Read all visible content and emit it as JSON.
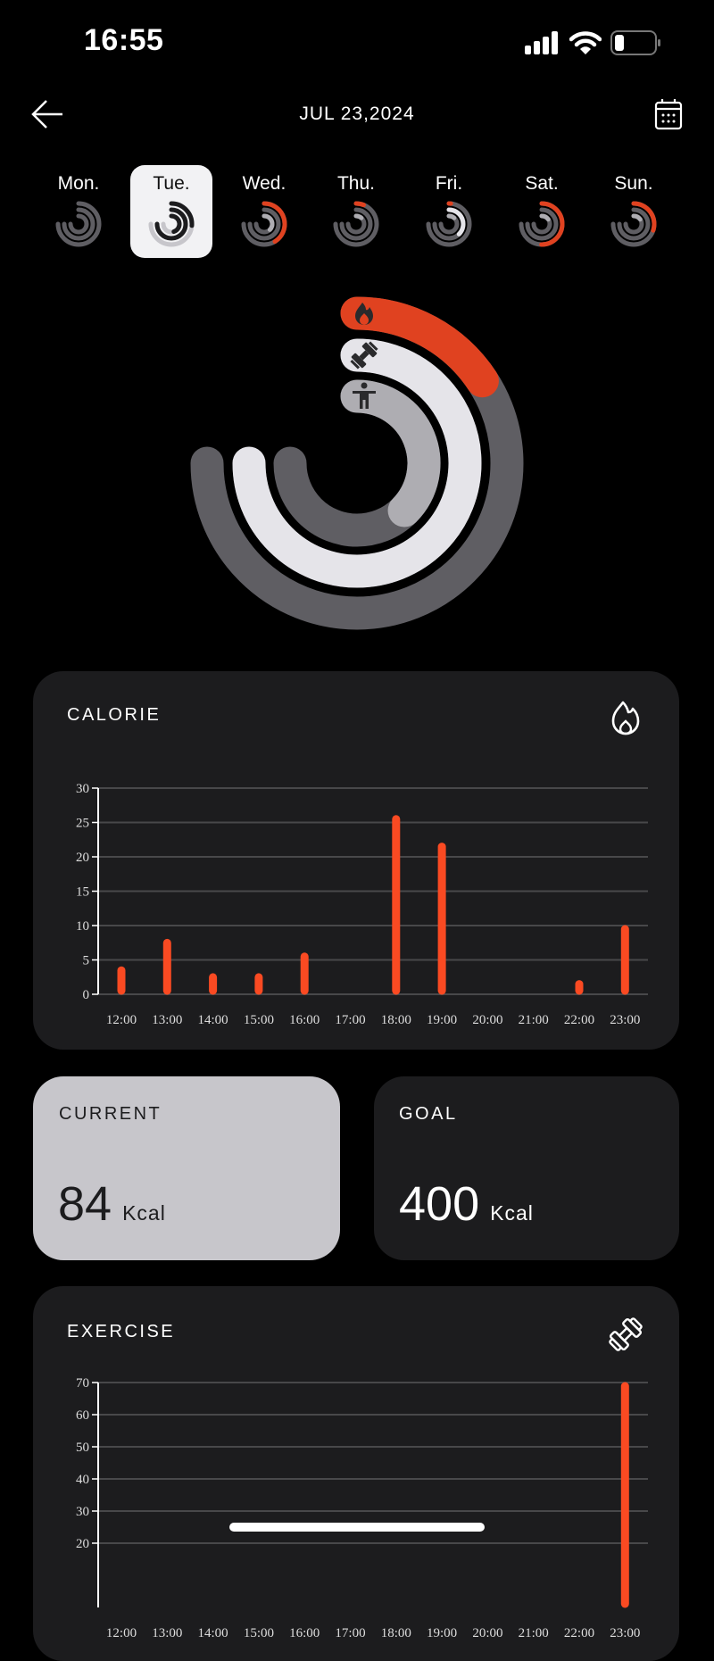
{
  "status_bar": {
    "time": "16:55",
    "signal_icon": "cellular-signal-icon",
    "wifi_icon": "wifi-icon",
    "battery_icon": "battery-low-icon"
  },
  "header": {
    "back_icon": "arrow-left-icon",
    "title": "JUL 23,2024",
    "calendar_icon": "calendar-icon"
  },
  "days": [
    {
      "label": "Mon.",
      "selected": false,
      "rings": [
        0,
        0,
        0
      ]
    },
    {
      "label": "Tue.",
      "selected": true,
      "rings": [
        0.35,
        1,
        0.6
      ]
    },
    {
      "label": "Wed.",
      "selected": false,
      "rings": [
        0.55,
        0,
        0.5
      ]
    },
    {
      "label": "Thu.",
      "selected": false,
      "rings": [
        0.08,
        0,
        0.15
      ]
    },
    {
      "label": "Fri.",
      "selected": false,
      "rings": [
        0.02,
        0.5,
        0.15
      ]
    },
    {
      "label": "Sat.",
      "selected": false,
      "rings": [
        0.67,
        0,
        0.2
      ]
    },
    {
      "label": "Sun.",
      "selected": false,
      "rings": [
        0.4,
        0,
        0.2
      ]
    }
  ],
  "activity_rings": {
    "calorie": {
      "progress": 0.21,
      "icon": "flame-icon",
      "color": "#e04220"
    },
    "exercise": {
      "progress": 1.0,
      "icon": "dumbbell-icon",
      "color": "#e5e4e9"
    },
    "stand": {
      "progress": 0.5,
      "icon": "person-standing-icon",
      "color": "#aeadb2"
    },
    "track_color": "#5f5e63"
  },
  "calorie_card": {
    "title": "CALORIE",
    "icon": "flame-outline-icon",
    "chart_data": {
      "type": "bar",
      "categories": [
        "12:00",
        "13:00",
        "14:00",
        "15:00",
        "16:00",
        "17:00",
        "18:00",
        "19:00",
        "20:00",
        "21:00",
        "22:00",
        "23:00"
      ],
      "values": [
        4,
        8,
        3,
        3,
        6,
        0,
        26,
        22,
        0,
        0,
        2,
        10
      ],
      "yticks": [
        "0",
        "5",
        "10",
        "15",
        "20",
        "25",
        "30"
      ],
      "ylim": [
        0,
        30
      ],
      "grid": true,
      "bar_color": "#fa4a22"
    }
  },
  "current": {
    "label": "CURRENT",
    "value": "84",
    "unit": "Kcal"
  },
  "goal": {
    "label": "GOAL",
    "value": "400",
    "unit": "Kcal"
  },
  "exercise_card": {
    "title": "EXERCISE",
    "icon": "dumbbell-outline-icon",
    "chart_data": {
      "type": "bar",
      "categories": [
        "12:00",
        "13:00",
        "14:00",
        "15:00",
        "16:00",
        "17:00",
        "18:00",
        "19:00",
        "20:00",
        "21:00",
        "22:00",
        "23:00"
      ],
      "values": [
        0,
        0,
        0,
        0,
        0,
        0,
        0,
        0,
        0,
        0,
        0,
        70
      ],
      "yticks": [
        "20",
        "30",
        "40",
        "50",
        "60",
        "70"
      ],
      "ylim": [
        0,
        70
      ],
      "grid": true,
      "bar_color": "#fa4a22"
    }
  }
}
